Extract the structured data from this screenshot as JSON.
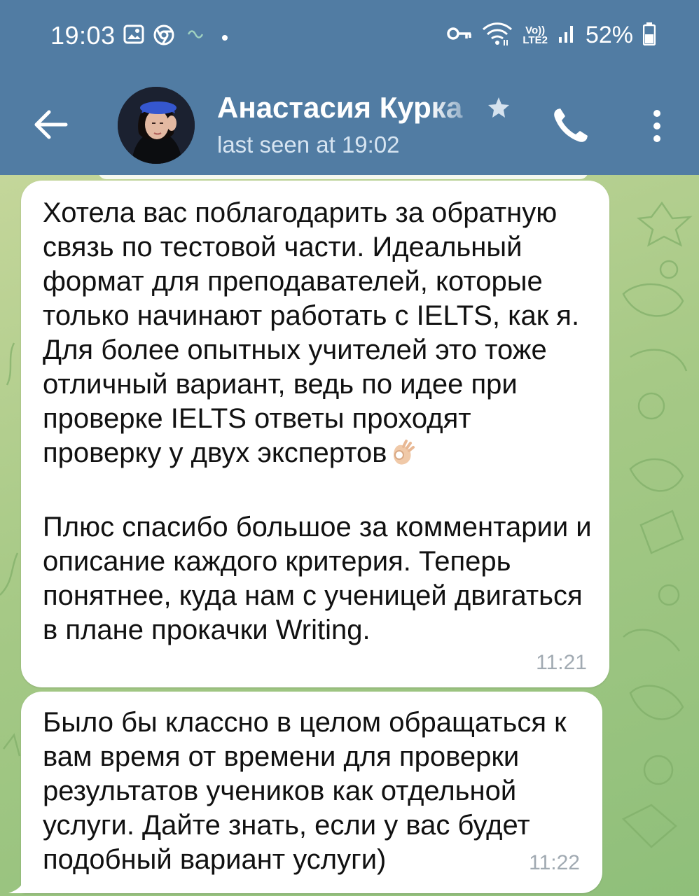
{
  "status_bar": {
    "time": "19:03",
    "battery": "52%",
    "network": "LTE2",
    "icons_left": [
      "gallery-icon",
      "chrome-icon",
      "link-icon",
      "dot-icon"
    ],
    "icons_right": [
      "key-icon",
      "wifi-icon",
      "volte-icon",
      "signal-icon",
      "battery-icon"
    ]
  },
  "header": {
    "contact_name": "Анастасия Курка",
    "last_seen": "last seen at 19:02",
    "icons": [
      "back-arrow-icon",
      "star-icon",
      "phone-icon",
      "more-vertical-icon"
    ]
  },
  "messages": [
    {
      "text_part1": "Хотела вас поблагодарить за обратную связь по тестовой части. Идеальный формат для преподавателей, которые только начинают работать с IELTS, как я. Для более опытных учителей это тоже отличный вариант, ведь по идее при проверке IELTS ответы проходят проверку у двух экспертов",
      "emoji": "👌",
      "text_part2": "Плюс спасибо большое за комментарии и описание каждого критерия. Теперь понятнее, куда нам с ученицей двигаться в плане прокачки Writing.",
      "time": "11:21"
    },
    {
      "text": "Было бы классно в целом обращаться к вам время от времени для проверки результатов учеников как отдельной услуги. Дайте знать, если у вас будет подобный вариант услуги)",
      "time": "11:22"
    }
  ],
  "colors": {
    "header_bg": "#517ca3",
    "bubble_bg": "#ffffff",
    "chat_bg": "#a6c986",
    "time_text": "#a1aab2"
  }
}
